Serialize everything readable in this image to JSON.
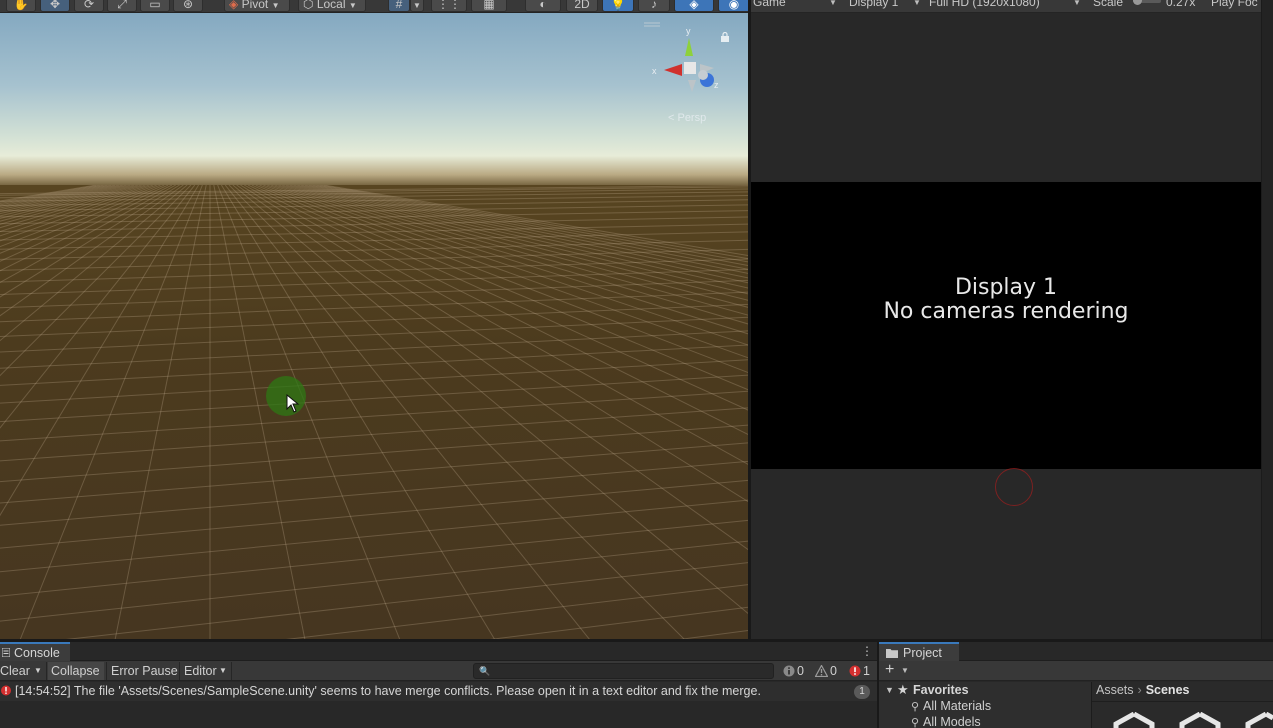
{
  "scene_view": {
    "toolbar": {
      "pivot_label": "Pivot",
      "local_label": "Local",
      "mode_2d_label": "2D"
    },
    "gizmo": {
      "y_axis": "y",
      "x_axis": "x",
      "z_axis": "z",
      "projection_label": "< Persp"
    }
  },
  "game_view": {
    "toolbar": {
      "view_label": "Game",
      "display_label": "Display 1",
      "resolution_label": "Full HD (1920x1080)",
      "scale_label": "Scale",
      "scale_value": "0.27x",
      "play_focus_label": "Play Foc"
    },
    "display_title": "Display 1",
    "display_message": "No cameras rendering"
  },
  "console": {
    "tab_label": "Console",
    "toolbar": {
      "clear_label": "Clear",
      "collapse_label": "Collapse",
      "error_pause_label": "Error Pause",
      "editor_label": "Editor",
      "info_count": "0",
      "warning_count": "0",
      "error_count": "1"
    },
    "entries": [
      {
        "type": "error",
        "text": "[14:54:52] The file 'Assets/Scenes/SampleScene.unity' seems to have merge conflicts. Please open it in a text editor and fix the merge.",
        "count": "1"
      }
    ]
  },
  "project": {
    "tab_label": "Project",
    "favorites": {
      "label": "Favorites",
      "items": [
        "All Materials",
        "All Models"
      ]
    },
    "breadcrumb": {
      "root": "Assets",
      "current": "Scenes"
    }
  },
  "colors": {
    "accent": "#3a79bb",
    "error": "#d32f2f",
    "ground": "#4a3a1e",
    "sky": "#a6c2cf"
  }
}
